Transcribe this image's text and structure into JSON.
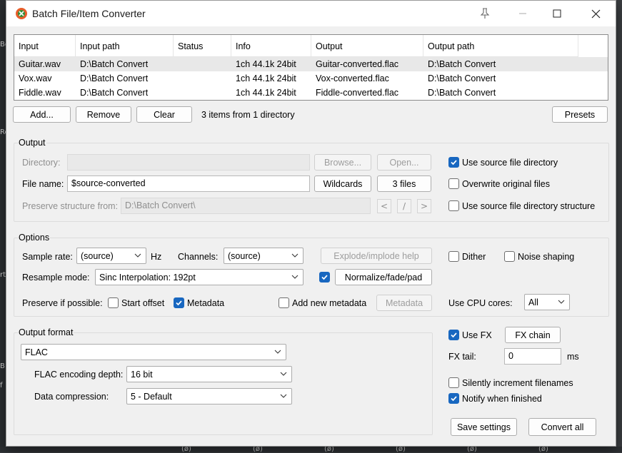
{
  "window": {
    "title": "Batch File/Item Converter"
  },
  "list": {
    "columns": [
      "Input",
      "Input path",
      "Status",
      "Info",
      "Output",
      "Output path"
    ],
    "rows": [
      {
        "input": "Guitar.wav",
        "input_path": "D:\\Batch Convert",
        "status": "",
        "info": "1ch 44.1k 24bit",
        "output": "Guitar-converted.flac",
        "output_path": "D:\\Batch Convert"
      },
      {
        "input": "Vox.wav",
        "input_path": "D:\\Batch Convert",
        "status": "",
        "info": "1ch 44.1k 24bit",
        "output": "Vox-converted.flac",
        "output_path": "D:\\Batch Convert"
      },
      {
        "input": "Fiddle.wav",
        "input_path": "D:\\Batch Convert",
        "status": "",
        "info": "1ch 44.1k 24bit",
        "output": "Fiddle-converted.flac",
        "output_path": "D:\\Batch Convert"
      }
    ]
  },
  "list_buttons": {
    "add": "Add...",
    "remove": "Remove",
    "clear": "Clear",
    "summary": "3 items from 1 directory",
    "presets": "Presets"
  },
  "output": {
    "title": "Output",
    "directory_label": "Directory:",
    "directory_value": "",
    "browse": "Browse...",
    "open": "Open...",
    "use_source_dir": "Use source file directory",
    "use_source_dir_checked": true,
    "filename_label": "File name:",
    "filename_value": "$source-converted",
    "wildcards": "Wildcards",
    "files_count": "3 files",
    "overwrite": "Overwrite original files",
    "overwrite_checked": false,
    "preserve_label": "Preserve structure from:",
    "preserve_value": "D:\\Batch Convert\\",
    "nav_prev": "<",
    "nav_slash": "/",
    "nav_next": ">",
    "use_source_structure": "Use source file directory structure",
    "use_source_structure_checked": false
  },
  "options": {
    "title": "Options",
    "sample_rate_label": "Sample rate:",
    "sample_rate_value": "(source)",
    "hz": "Hz",
    "channels_label": "Channels:",
    "channels_value": "(source)",
    "explode_help": "Explode/implode help",
    "dither": "Dither",
    "dither_checked": false,
    "noise_shaping": "Noise shaping",
    "noise_shaping_checked": false,
    "resample_label": "Resample mode:",
    "resample_value": "Sinc Interpolation: 192pt",
    "normalize_checked": true,
    "normalize": "Normalize/fade/pad",
    "preserve_label": "Preserve if possible:",
    "start_offset": "Start offset",
    "start_offset_checked": false,
    "metadata": "Metadata",
    "metadata_checked": true,
    "add_metadata": "Add new metadata",
    "add_metadata_checked": false,
    "metadata_button": "Metadata",
    "cpu_label": "Use CPU cores:",
    "cpu_value": "All"
  },
  "format": {
    "title": "Output format",
    "format_value": "FLAC",
    "depth_label": "FLAC encoding depth:",
    "depth_value": "16 bit",
    "compression_label": "Data compression:",
    "compression_value": "5 - Default"
  },
  "fx": {
    "use_fx": "Use FX",
    "use_fx_checked": true,
    "fx_chain": "FX chain",
    "tail_label": "FX tail:",
    "tail_value": "0",
    "tail_unit": "ms",
    "silently": "Silently increment filenames",
    "silently_checked": false,
    "notify": "Notify when finished",
    "notify_checked": true
  },
  "actions": {
    "save": "Save settings",
    "convert": "Convert all"
  },
  "background": {
    "left_labels": [
      "Bo",
      "Re",
      "rt",
      "B",
      "f"
    ],
    "bottom_markers": [
      "(ø)",
      "(ø)",
      "(ø)",
      "(ø)",
      "(ø)",
      "(ø)"
    ]
  }
}
